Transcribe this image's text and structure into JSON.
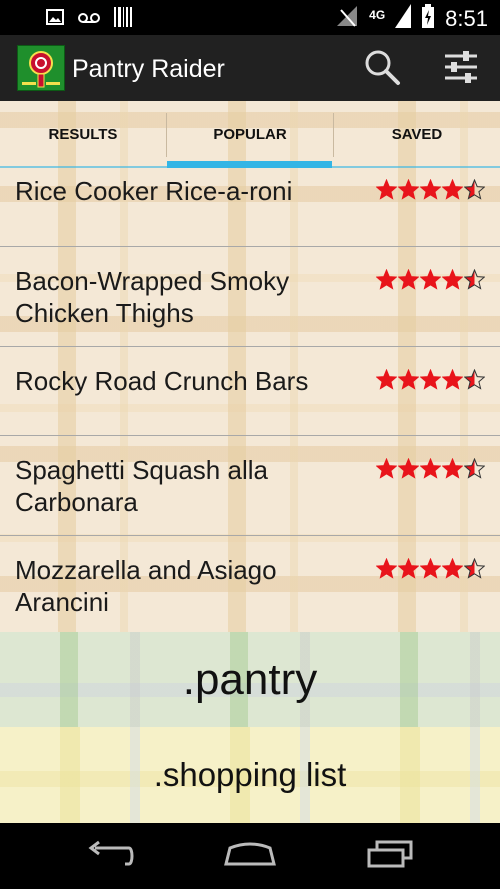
{
  "status_bar": {
    "time": "8:51",
    "network": "4G",
    "icons": [
      "image-icon",
      "voicemail-icon",
      "barcode-icon",
      "signal-icon",
      "battery-icon"
    ]
  },
  "action_bar": {
    "title": "Pantry Raider",
    "icons": [
      "app-logo-icon",
      "search-icon",
      "settings-sliders-icon"
    ]
  },
  "tabs": [
    {
      "label": "RESULTS",
      "selected": false
    },
    {
      "label": "POPULAR",
      "selected": true
    },
    {
      "label": "SAVED",
      "selected": false
    }
  ],
  "recipes": [
    {
      "name": "Rice Cooker Rice-a-roni",
      "rating": 4.5
    },
    {
      "name": "Bacon-Wrapped Smoky Chicken Thighs",
      "rating": 4.5
    },
    {
      "name": "Rocky Road Crunch Bars",
      "rating": 4.5
    },
    {
      "name": "Spaghetti Squash alla Carbonara",
      "rating": 4.5
    },
    {
      "name": "Mozzarella and Asiago Arancini",
      "rating": 4.5
    }
  ],
  "bottom_buttons": {
    "pantry": ".pantry",
    "shopping_list": ".shopping list"
  },
  "colors": {
    "accent": "#33b5e5",
    "star": "#e8141b",
    "action_bar": "#212121",
    "logo_green": "#1f8f2c"
  },
  "nav_bar": {
    "icons": [
      "back-icon",
      "home-icon",
      "recent-apps-icon"
    ]
  }
}
